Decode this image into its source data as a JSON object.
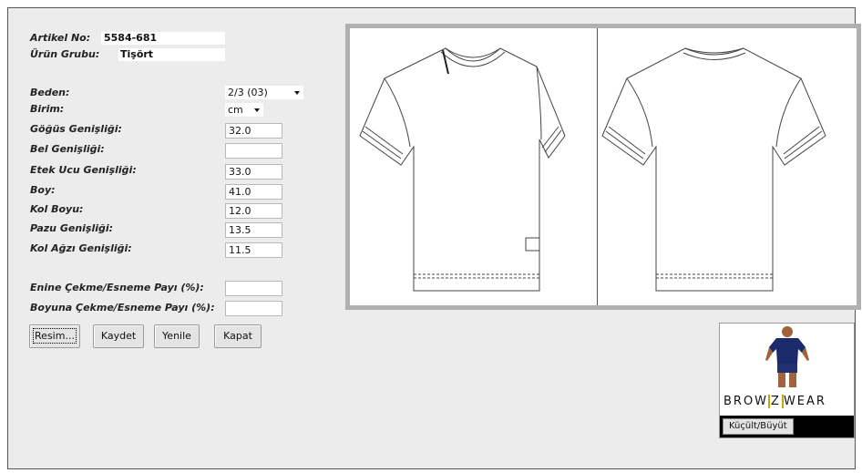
{
  "header": {
    "article_label": "Artikel No:",
    "article_value": "5584-681",
    "group_label": "Ürün Grubu:",
    "group_value": "Tişört"
  },
  "form": {
    "size_label": "Beden:",
    "size_value": "2/3 (03)",
    "unit_label": "Birim:",
    "unit_value": "cm",
    "fields": [
      {
        "label": "Göğüs Genişliği:",
        "value": "32.0"
      },
      {
        "label": "Bel Genişliği:",
        "value": ""
      },
      {
        "label": "Etek Ucu Genişliği:",
        "value": "33.0"
      },
      {
        "label": "Boy:",
        "value": "41.0"
      },
      {
        "label": "Kol Boyu:",
        "value": "12.0"
      },
      {
        "label": "Pazu Genişliği:",
        "value": "13.5"
      },
      {
        "label": "Kol Ağzı Genişliği:",
        "value": "11.5"
      }
    ],
    "shrink_width_label": "Enine Çekme/Esneme Payı (%):",
    "shrink_width_value": "",
    "shrink_length_label": "Boyuna Çekme/Esneme Payı (%):",
    "shrink_length_value": ""
  },
  "buttons": {
    "image": "Resim...",
    "save": "Kaydet",
    "refresh": "Yenile",
    "close": "Kapat"
  },
  "avatar": {
    "logo_left": "BROW",
    "logo_z": "Z",
    "logo_right": "WEAR",
    "toggle": "Küçült/Büyüt"
  }
}
